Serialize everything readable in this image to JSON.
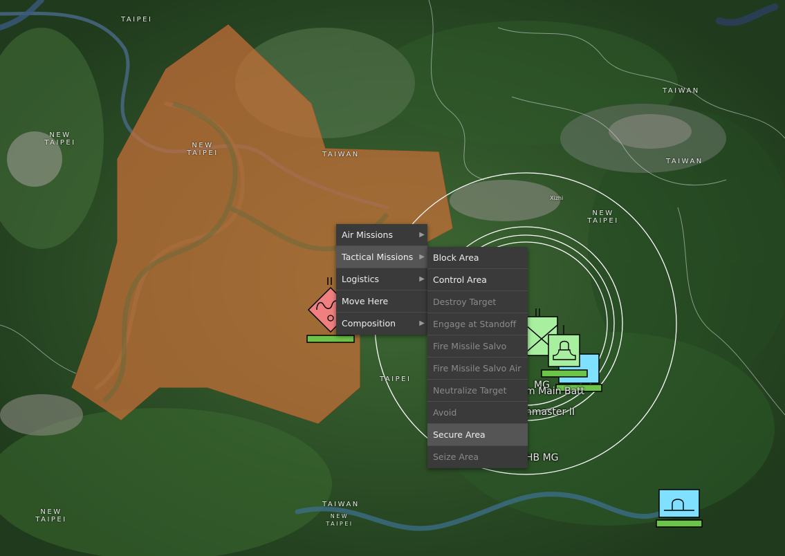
{
  "map": {
    "place_labels": [
      "TAIPEI",
      "NEW TAIPEI",
      "TAIWAN",
      "Xizhi"
    ],
    "colors": {
      "area_fill": "#c86f38",
      "hostile": "#f08080",
      "friendly_green": "#a8f0a0",
      "friendly_blue": "#80e0ff",
      "health_bar": "#6cc44a",
      "range_ring": "#ffffff"
    }
  },
  "units": {
    "hostile": {
      "icon": "hostile-armor-icon"
    },
    "label_1": "MG",
    "label_2": "m Main Batt",
    "label_3": "hmaster II",
    "label_4": "HB MG",
    "friendly_icons": [
      "friendly-infantry-icon",
      "friendly-armor-icon",
      "friendly-armor-icon",
      "friendly-armor-icon"
    ]
  },
  "context_menu": {
    "items": [
      {
        "label": "Air Missions",
        "has_submenu": true
      },
      {
        "label": "Tactical Missions",
        "has_submenu": true,
        "highlighted": true
      },
      {
        "label": "Logistics",
        "has_submenu": true
      },
      {
        "label": "Move Here",
        "has_submenu": false
      },
      {
        "label": "Composition",
        "has_submenu": true
      }
    ],
    "submenu": [
      {
        "label": "Block Area",
        "enabled": true
      },
      {
        "label": "Control Area",
        "enabled": true
      },
      {
        "label": "Destroy Target",
        "enabled": false
      },
      {
        "label": "Engage at Standoff",
        "enabled": false
      },
      {
        "label": "Fire Missile Salvo",
        "enabled": false
      },
      {
        "label": "Fire Missile Salvo Air",
        "enabled": false
      },
      {
        "label": "Neutralize Target",
        "enabled": false
      },
      {
        "label": "Avoid",
        "enabled": false
      },
      {
        "label": "Secure Area",
        "enabled": true,
        "highlighted": true
      },
      {
        "label": "Seize Area",
        "enabled": false
      }
    ]
  }
}
